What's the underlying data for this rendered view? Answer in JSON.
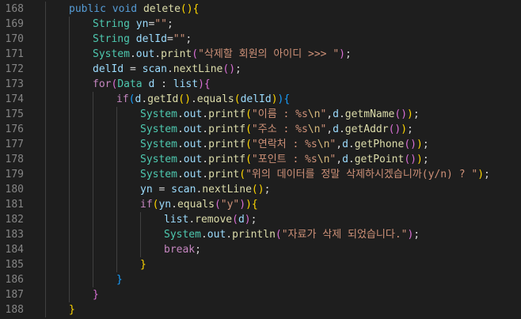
{
  "editor": {
    "lines": [
      {
        "num": "168",
        "indent": 1,
        "tokens": [
          [
            "kw",
            "public"
          ],
          [
            "pl",
            " "
          ],
          [
            "kw",
            "void"
          ],
          [
            "pl",
            " "
          ],
          [
            "fn",
            "delete"
          ],
          [
            "b1",
            "()"
          ],
          [
            "b1",
            "{"
          ]
        ]
      },
      {
        "num": "169",
        "indent": 2,
        "tokens": [
          [
            "type",
            "String"
          ],
          [
            "pl",
            " "
          ],
          [
            "var",
            "yn"
          ],
          [
            "pl",
            "="
          ],
          [
            "str",
            "\"\""
          ],
          [
            "pl",
            ";"
          ]
        ]
      },
      {
        "num": "170",
        "indent": 2,
        "tokens": [
          [
            "type",
            "String"
          ],
          [
            "pl",
            " "
          ],
          [
            "var",
            "delId"
          ],
          [
            "pl",
            "="
          ],
          [
            "str",
            "\"\""
          ],
          [
            "pl",
            ";"
          ]
        ]
      },
      {
        "num": "171",
        "indent": 2,
        "tokens": [
          [
            "type",
            "System"
          ],
          [
            "pl",
            "."
          ],
          [
            "var",
            "out"
          ],
          [
            "pl",
            "."
          ],
          [
            "fn",
            "print"
          ],
          [
            "b2",
            "("
          ],
          [
            "str",
            "\"삭제할 회원의 아이디 >>> \""
          ],
          [
            "b2",
            ")"
          ],
          [
            "pl",
            ";"
          ]
        ]
      },
      {
        "num": "172",
        "indent": 2,
        "tokens": [
          [
            "var",
            "delId"
          ],
          [
            "pl",
            " = "
          ],
          [
            "var",
            "scan"
          ],
          [
            "pl",
            "."
          ],
          [
            "fn",
            "nextLine"
          ],
          [
            "b2",
            "()"
          ],
          [
            "pl",
            ";"
          ]
        ]
      },
      {
        "num": "173",
        "indent": 2,
        "tokens": [
          [
            "ctl",
            "for"
          ],
          [
            "b2",
            "("
          ],
          [
            "type",
            "Data"
          ],
          [
            "pl",
            " "
          ],
          [
            "var",
            "d"
          ],
          [
            "pl",
            " : "
          ],
          [
            "var",
            "list"
          ],
          [
            "b2",
            ")"
          ],
          [
            "b2",
            "{"
          ]
        ]
      },
      {
        "num": "174",
        "indent": 3,
        "tokens": [
          [
            "ctl",
            "if"
          ],
          [
            "b3",
            "("
          ],
          [
            "var",
            "d"
          ],
          [
            "pl",
            "."
          ],
          [
            "fn",
            "getId"
          ],
          [
            "b1",
            "()"
          ],
          [
            "pl",
            "."
          ],
          [
            "fn",
            "equals"
          ],
          [
            "b1",
            "("
          ],
          [
            "var",
            "delId"
          ],
          [
            "b1",
            ")"
          ],
          [
            "b3",
            ")"
          ],
          [
            "b3",
            "{"
          ]
        ]
      },
      {
        "num": "175",
        "indent": 4,
        "tokens": [
          [
            "type",
            "System"
          ],
          [
            "pl",
            "."
          ],
          [
            "var",
            "out"
          ],
          [
            "pl",
            "."
          ],
          [
            "fn",
            "printf"
          ],
          [
            "b1",
            "("
          ],
          [
            "str",
            "\"이름 : %s"
          ],
          [
            "esc",
            "\\n"
          ],
          [
            "str",
            "\""
          ],
          [
            "pl",
            ","
          ],
          [
            "var",
            "d"
          ],
          [
            "pl",
            "."
          ],
          [
            "fn",
            "getmName"
          ],
          [
            "b2",
            "()"
          ],
          [
            "b1",
            ")"
          ],
          [
            "pl",
            ";"
          ]
        ]
      },
      {
        "num": "176",
        "indent": 4,
        "tokens": [
          [
            "type",
            "System"
          ],
          [
            "pl",
            "."
          ],
          [
            "var",
            "out"
          ],
          [
            "pl",
            "."
          ],
          [
            "fn",
            "printf"
          ],
          [
            "b1",
            "("
          ],
          [
            "str",
            "\"주소 : %s"
          ],
          [
            "esc",
            "\\n"
          ],
          [
            "str",
            "\""
          ],
          [
            "pl",
            ","
          ],
          [
            "var",
            "d"
          ],
          [
            "pl",
            "."
          ],
          [
            "fn",
            "getAddr"
          ],
          [
            "b2",
            "()"
          ],
          [
            "b1",
            ")"
          ],
          [
            "pl",
            ";"
          ]
        ]
      },
      {
        "num": "177",
        "indent": 4,
        "tokens": [
          [
            "type",
            "System"
          ],
          [
            "pl",
            "."
          ],
          [
            "var",
            "out"
          ],
          [
            "pl",
            "."
          ],
          [
            "fn",
            "printf"
          ],
          [
            "b1",
            "("
          ],
          [
            "str",
            "\"연락처 : %s"
          ],
          [
            "esc",
            "\\n"
          ],
          [
            "str",
            "\""
          ],
          [
            "pl",
            ","
          ],
          [
            "var",
            "d"
          ],
          [
            "pl",
            "."
          ],
          [
            "fn",
            "getPhone"
          ],
          [
            "b2",
            "()"
          ],
          [
            "b1",
            ")"
          ],
          [
            "pl",
            ";"
          ]
        ]
      },
      {
        "num": "178",
        "indent": 4,
        "tokens": [
          [
            "type",
            "System"
          ],
          [
            "pl",
            "."
          ],
          [
            "var",
            "out"
          ],
          [
            "pl",
            "."
          ],
          [
            "fn",
            "printf"
          ],
          [
            "b1",
            "("
          ],
          [
            "str",
            "\"포인트 : %s"
          ],
          [
            "esc",
            "\\n"
          ],
          [
            "str",
            "\""
          ],
          [
            "pl",
            ","
          ],
          [
            "var",
            "d"
          ],
          [
            "pl",
            "."
          ],
          [
            "fn",
            "getPoint"
          ],
          [
            "b2",
            "()"
          ],
          [
            "b1",
            ")"
          ],
          [
            "pl",
            ";"
          ]
        ]
      },
      {
        "num": "179",
        "indent": 4,
        "tokens": [
          [
            "type",
            "System"
          ],
          [
            "pl",
            "."
          ],
          [
            "var",
            "out"
          ],
          [
            "pl",
            "."
          ],
          [
            "fn",
            "print"
          ],
          [
            "b1",
            "("
          ],
          [
            "str",
            "\"위의 데이터를 정말 삭제하시겠습니까(y/n) ? \""
          ],
          [
            "b1",
            ")"
          ],
          [
            "pl",
            ";"
          ]
        ]
      },
      {
        "num": "180",
        "indent": 4,
        "tokens": [
          [
            "var",
            "yn"
          ],
          [
            "pl",
            " = "
          ],
          [
            "var",
            "scan"
          ],
          [
            "pl",
            "."
          ],
          [
            "fn",
            "nextLine"
          ],
          [
            "b1",
            "()"
          ],
          [
            "pl",
            ";"
          ]
        ]
      },
      {
        "num": "181",
        "indent": 4,
        "tokens": [
          [
            "ctl",
            "if"
          ],
          [
            "b1",
            "("
          ],
          [
            "var",
            "yn"
          ],
          [
            "pl",
            "."
          ],
          [
            "fn",
            "equals"
          ],
          [
            "b2",
            "("
          ],
          [
            "str",
            "\"y\""
          ],
          [
            "b2",
            ")"
          ],
          [
            "b1",
            ")"
          ],
          [
            "b1",
            "{"
          ]
        ]
      },
      {
        "num": "182",
        "indent": 5,
        "tokens": [
          [
            "var",
            "list"
          ],
          [
            "pl",
            "."
          ],
          [
            "fn",
            "remove"
          ],
          [
            "b2",
            "("
          ],
          [
            "var",
            "d"
          ],
          [
            "b2",
            ")"
          ],
          [
            "pl",
            ";"
          ]
        ]
      },
      {
        "num": "183",
        "indent": 5,
        "tokens": [
          [
            "type",
            "System"
          ],
          [
            "pl",
            "."
          ],
          [
            "var",
            "out"
          ],
          [
            "pl",
            "."
          ],
          [
            "fn",
            "println"
          ],
          [
            "b2",
            "("
          ],
          [
            "str",
            "\"자료가 삭제 되었습니다.\""
          ],
          [
            "b2",
            ")"
          ],
          [
            "pl",
            ";"
          ]
        ]
      },
      {
        "num": "184",
        "indent": 5,
        "tokens": [
          [
            "ctl",
            "break"
          ],
          [
            "pl",
            ";"
          ]
        ]
      },
      {
        "num": "185",
        "indent": 4,
        "tokens": [
          [
            "b1",
            "}"
          ]
        ]
      },
      {
        "num": "186",
        "indent": 3,
        "tokens": [
          [
            "b3",
            "}"
          ]
        ]
      },
      {
        "num": "187",
        "indent": 2,
        "tokens": [
          [
            "b2",
            "}"
          ]
        ]
      },
      {
        "num": "188",
        "indent": 1,
        "tokens": [
          [
            "b1",
            "}"
          ]
        ]
      }
    ]
  },
  "colors": {
    "background": "#1e1e1e",
    "line_number": "#858585",
    "keyword": "#569cd6",
    "control": "#c586c0",
    "type": "#4ec9b0",
    "variable": "#9cdcfe",
    "function": "#dcdcaa",
    "string": "#ce9178",
    "escape": "#d7ba7d",
    "bracket_1": "#ffd700",
    "bracket_2": "#da70d6",
    "bracket_3": "#179fff"
  }
}
